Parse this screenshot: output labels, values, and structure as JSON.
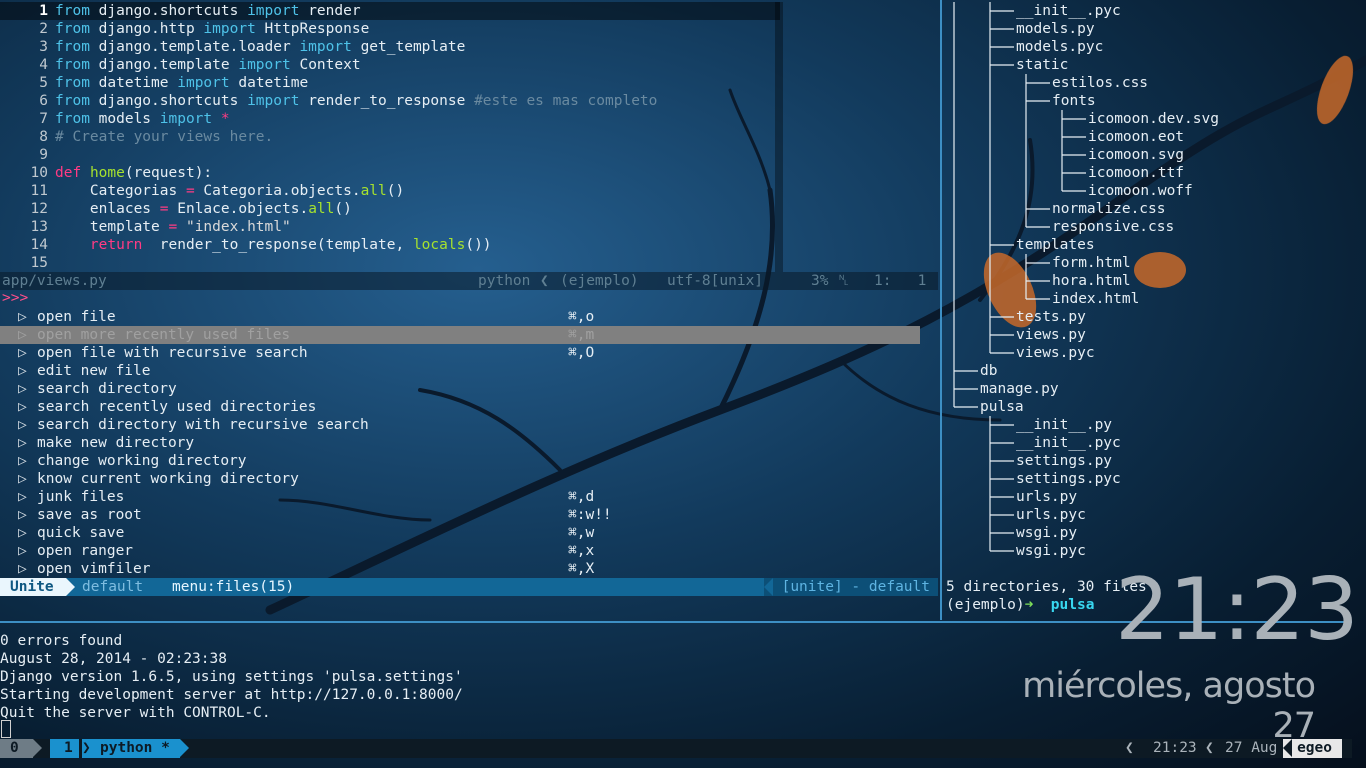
{
  "editor": {
    "lines": [
      {
        "n": "1",
        "tokens": [
          [
            "kw",
            "from"
          ],
          [
            "",
            "django.shortcuts "
          ],
          [
            "kw",
            "import"
          ],
          [
            "",
            "render"
          ]
        ]
      },
      {
        "n": "2",
        "tokens": [
          [
            "kw",
            "from"
          ],
          [
            "",
            "django.http "
          ],
          [
            "kw",
            "import"
          ],
          [
            "",
            "HttpResponse"
          ]
        ]
      },
      {
        "n": "3",
        "tokens": [
          [
            "kw",
            "from"
          ],
          [
            "",
            "django.template.loader "
          ],
          [
            "kw",
            "import"
          ],
          [
            "",
            "get_template"
          ]
        ]
      },
      {
        "n": "4",
        "tokens": [
          [
            "kw",
            "from"
          ],
          [
            "",
            "django.template "
          ],
          [
            "kw",
            "import"
          ],
          [
            "",
            "Context"
          ]
        ]
      },
      {
        "n": "5",
        "tokens": [
          [
            "kw",
            "from"
          ],
          [
            "",
            "datetime "
          ],
          [
            "kw",
            "import"
          ],
          [
            "",
            "datetime"
          ]
        ]
      },
      {
        "n": "6",
        "tokens": [
          [
            "kw",
            "from"
          ],
          [
            "",
            "django.shortcuts "
          ],
          [
            "kw",
            "import"
          ],
          [
            "",
            "render_to_response "
          ],
          [
            "cm",
            "#este es mas completo"
          ]
        ]
      },
      {
        "n": "7",
        "tokens": [
          [
            "kw",
            "from"
          ],
          [
            "",
            "models "
          ],
          [
            "kw",
            "import"
          ],
          [
            "op",
            "*"
          ]
        ]
      },
      {
        "n": "8",
        "tokens": [
          [
            "cm",
            "# Create your views here."
          ]
        ]
      },
      {
        "n": "9",
        "tokens": []
      },
      {
        "n": "10",
        "tokens": [
          [
            "kw2",
            "def"
          ],
          [
            "fn",
            "home"
          ],
          [
            "",
            "(request):"
          ]
        ]
      },
      {
        "n": "11",
        "tokens": [
          [
            "",
            "    Categorias "
          ],
          [
            "op",
            "="
          ],
          [
            "",
            " Categoria.objects."
          ],
          [
            "fn",
            "all"
          ],
          [
            "",
            "()"
          ]
        ]
      },
      {
        "n": "12",
        "tokens": [
          [
            "",
            "    enlaces "
          ],
          [
            "op",
            "="
          ],
          [
            "",
            " Enlace.objects."
          ],
          [
            "fn",
            "all"
          ],
          [
            "",
            "()"
          ]
        ]
      },
      {
        "n": "13",
        "tokens": [
          [
            "",
            "    template "
          ],
          [
            "op",
            "="
          ],
          [
            "str",
            " \"index.html\""
          ]
        ]
      },
      {
        "n": "14",
        "tokens": [
          [
            "kw2",
            "    return"
          ],
          [
            "",
            " render_to_response(template, "
          ],
          [
            "fn",
            "locals"
          ],
          [
            "",
            "())"
          ]
        ]
      },
      {
        "n": "15",
        "tokens": []
      }
    ],
    "status": {
      "file": "app/views.py",
      "filetype": "python",
      "env": "(ejemplo)",
      "encoding": "utf-8[unix]",
      "percent": "3%",
      "position": "1:   1"
    }
  },
  "unite": {
    "prompt": ">>>",
    "items": [
      {
        "label": "open file",
        "shortcut": "⌘,o",
        "selected": false
      },
      {
        "label": "open more recently used files",
        "shortcut": "⌘,m",
        "selected": true
      },
      {
        "label": "open file with recursive search",
        "shortcut": "⌘,O",
        "selected": false
      },
      {
        "label": "edit new file",
        "shortcut": "",
        "selected": false
      },
      {
        "label": "search directory",
        "shortcut": "",
        "selected": false
      },
      {
        "label": "search recently used directories",
        "shortcut": "",
        "selected": false
      },
      {
        "label": "search directory with recursive search",
        "shortcut": "",
        "selected": false
      },
      {
        "label": "make new directory",
        "shortcut": "",
        "selected": false
      },
      {
        "label": "change working directory",
        "shortcut": "",
        "selected": false
      },
      {
        "label": "know current working directory",
        "shortcut": "",
        "selected": false
      },
      {
        "label": "junk files",
        "shortcut": "⌘,d",
        "selected": false
      },
      {
        "label": "save as root",
        "shortcut": "⌘:w!!",
        "selected": false
      },
      {
        "label": "quick save",
        "shortcut": "⌘,w",
        "selected": false
      },
      {
        "label": "open ranger",
        "shortcut": "⌘,x",
        "selected": false
      },
      {
        "label": "open vimfiler",
        "shortcut": "⌘,X",
        "selected": false
      }
    ],
    "status": {
      "mode": "Unite",
      "profile": "default",
      "source": "menu:files(15)",
      "right": "[unite] - default"
    }
  },
  "tree": {
    "items": [
      {
        "name": "__init__.pyc",
        "depth": 2
      },
      {
        "name": "models.py",
        "depth": 2
      },
      {
        "name": "models.pyc",
        "depth": 2
      },
      {
        "name": "static",
        "depth": 2
      },
      {
        "name": "estilos.css",
        "depth": 3
      },
      {
        "name": "fonts",
        "depth": 3
      },
      {
        "name": "icomoon.dev.svg",
        "depth": 4
      },
      {
        "name": "icomoon.eot",
        "depth": 4
      },
      {
        "name": "icomoon.svg",
        "depth": 4
      },
      {
        "name": "icomoon.ttf",
        "depth": 4
      },
      {
        "name": "icomoon.woff",
        "depth": 4
      },
      {
        "name": "normalize.css",
        "depth": 3
      },
      {
        "name": "responsive.css",
        "depth": 3
      },
      {
        "name": "templates",
        "depth": 2
      },
      {
        "name": "form.html",
        "depth": 3
      },
      {
        "name": "hora.html",
        "depth": 3
      },
      {
        "name": "index.html",
        "depth": 3
      },
      {
        "name": "tests.py",
        "depth": 2
      },
      {
        "name": "views.py",
        "depth": 2
      },
      {
        "name": "views.pyc",
        "depth": 2
      },
      {
        "name": "db",
        "depth": 1
      },
      {
        "name": "manage.py",
        "depth": 1
      },
      {
        "name": "pulsa",
        "depth": 1
      },
      {
        "name": "__init__.py",
        "depth": 2
      },
      {
        "name": "__init__.pyc",
        "depth": 2
      },
      {
        "name": "settings.py",
        "depth": 2
      },
      {
        "name": "settings.pyc",
        "depth": 2
      },
      {
        "name": "urls.py",
        "depth": 2
      },
      {
        "name": "urls.pyc",
        "depth": 2
      },
      {
        "name": "wsgi.py",
        "depth": 2
      },
      {
        "name": "wsgi.pyc",
        "depth": 2
      }
    ],
    "summary": "5 directories, 30 files",
    "prompt_env": "(ejemplo)",
    "prompt_arrow": "➜",
    "prompt_dir": "pulsa"
  },
  "terminal": {
    "lines": [
      "0 errors found",
      "August 28, 2014 - 02:23:38",
      "Django version 1.6.5, using settings 'pulsa.settings'",
      "Starting development server at http://127.0.0.1:8000/",
      "Quit the server with CONTROL-C."
    ]
  },
  "clock": {
    "time": "21:23",
    "date": "miércoles, agosto 27"
  },
  "tmux": {
    "session": "0",
    "window_index": "1",
    "window_name": "python *",
    "time": "21:23",
    "date": "27 Aug",
    "host": "egeo"
  },
  "colors": {
    "accent": "#1a91ce",
    "keyword": "#4ec2e8",
    "def_keyword": "#ff3b84",
    "function": "#a6e22e",
    "comment": "#6a8aa0"
  }
}
